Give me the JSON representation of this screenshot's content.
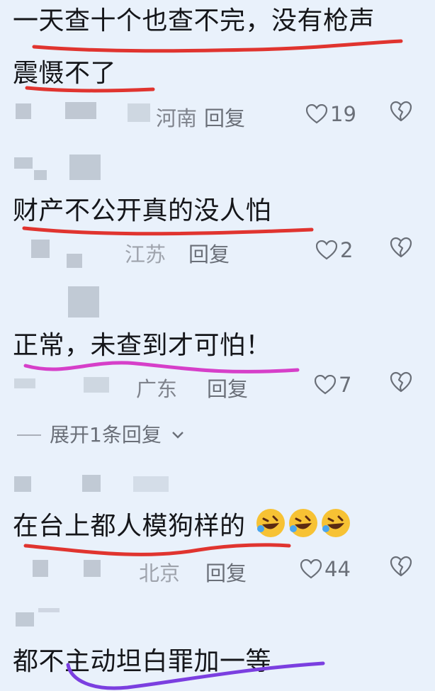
{
  "comments": [
    {
      "text_line1": "一天查十个也查不完，没有枪声",
      "text_line2": "震慑不了",
      "region": "河南",
      "reply_label": "回复",
      "likes": "19"
    },
    {
      "text_line1": "财产不公开真的没人怕",
      "region": "江苏",
      "reply_label": "回复",
      "likes": "2"
    },
    {
      "text_line1": "正常，未查到才可怕！",
      "region": "广东",
      "reply_label": "回复",
      "likes": "7",
      "expand_label": "展开1条回复"
    },
    {
      "text_line1": "在台上都人模狗样的",
      "emoji": [
        "rofl-emoji",
        "rofl-emoji",
        "rofl-emoji"
      ],
      "region": "北京",
      "reply_label": "回复",
      "likes": "44"
    },
    {
      "text_line1": "都不主动坦白罪加一等"
    }
  ],
  "icons": {
    "like": "heart-outline-icon",
    "dislike": "broken-heart-icon",
    "expand": "chevron-down-icon"
  },
  "colors": {
    "background": "#e9f1fb",
    "red_underline": "#e0342f",
    "pink_underline": "#d63fc9",
    "purple_underline": "#7b3fe0",
    "meta_text": "#6a6f78"
  }
}
